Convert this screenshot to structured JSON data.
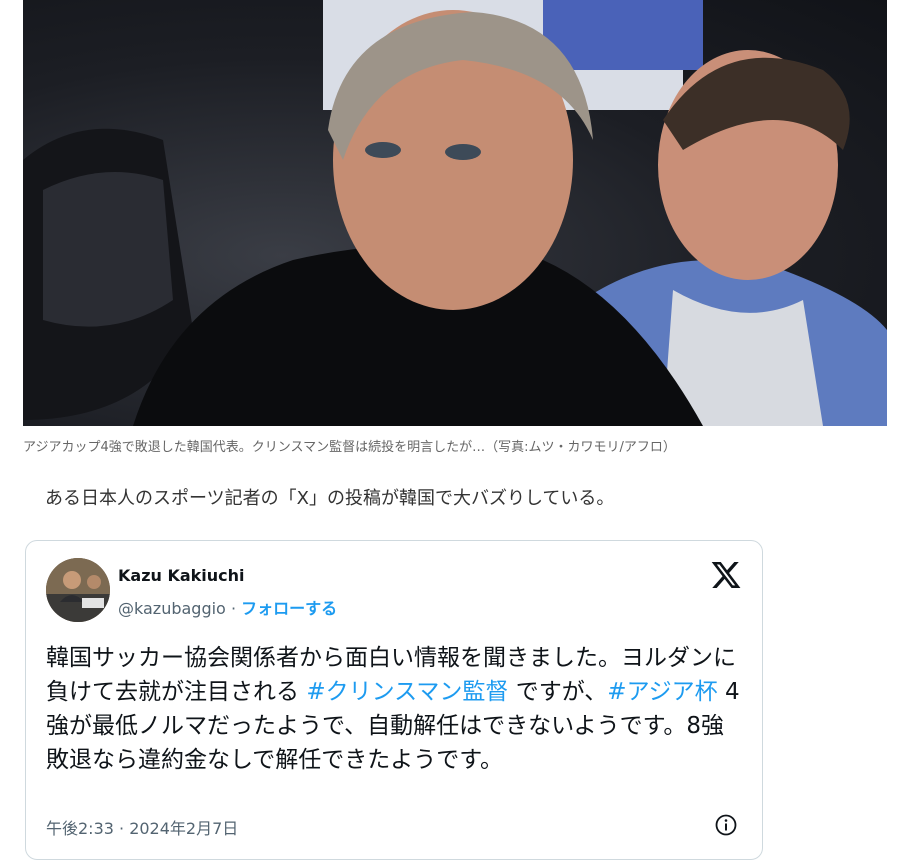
{
  "article": {
    "photo_alt": "Photo",
    "caption": "アジアカップ4強で敗退した韓国代表。クリンスマン監督は続投を明言したが…（写真:ムツ・カワモリ/アフロ）",
    "lead": "ある日本人のスポーツ記者の「X」の投稿が韓国で大バズりしている。"
  },
  "tweet": {
    "author_name": "Kazu Kakiuchi",
    "handle": "@kazubaggio",
    "separator": "·",
    "follow_label": "フォローする",
    "text_part1": "韓国サッカー協会関係者から面白い情報を聞きました。ヨルダンに負けて去就が注目される ",
    "hashtag1": "#クリンスマン監督",
    "text_part2": " ですが、",
    "hashtag2": "#アジア杯",
    "text_part3": " 4強が最低ノルマだったようで、自動解任はできないようです。8強敗退なら違約金なしで解任できたようです。",
    "timestamp": "午後2:33 · 2024年2月7日",
    "icons": {
      "platform": "x-logo-icon",
      "info": "info-icon"
    },
    "colors": {
      "link": "#1d9bf0",
      "text": "#0f1419",
      "muted": "#536471",
      "border": "#cfd9de"
    }
  }
}
